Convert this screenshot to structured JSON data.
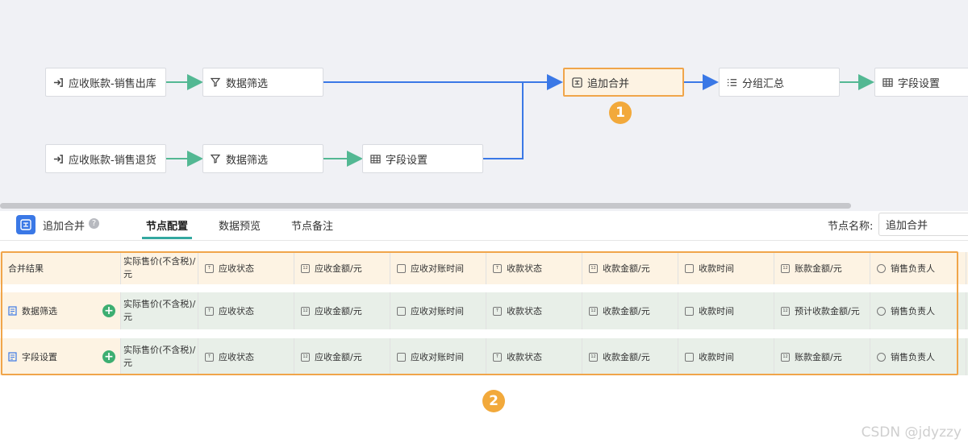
{
  "flow": {
    "nodes": [
      {
        "label": "应收账款-销售出库",
        "icon": "input-icon"
      },
      {
        "label": "数据筛选",
        "icon": "filter-icon"
      },
      {
        "label": "追加合并",
        "icon": "merge-icon"
      },
      {
        "label": "分组汇总",
        "icon": "list-icon"
      },
      {
        "label": "字段设置",
        "icon": "table-icon"
      },
      {
        "label": "应收账款-销售退货",
        "icon": "input-icon"
      },
      {
        "label": "数据筛选",
        "icon": "filter-icon"
      },
      {
        "label": "字段设置",
        "icon": "table-icon"
      }
    ],
    "badge1": "1",
    "badge2": "2",
    "colors": {
      "merge_edge": "#3a78e6",
      "flow_edge": "#53b893",
      "highlight": "#f0a54a"
    }
  },
  "panel": {
    "title": "追加合并",
    "help": "?",
    "tabs": [
      "节点配置",
      "数据预览",
      "节点备注"
    ],
    "active_tab": "节点配置",
    "node_name_label": "节点名称:",
    "node_name_value": "追加合并"
  },
  "table": {
    "rows": [
      {
        "label": "合并结果",
        "add": false,
        "cells": [
          "实际售价(不含税)/元",
          "应收状态",
          "应收金额/元",
          "应收对账时间",
          "收款状态",
          "收款金额/元",
          "收款时间",
          "账款金额/元",
          "销售负责人"
        ]
      },
      {
        "label": "数据筛选",
        "add": true,
        "cells": [
          "实际售价(不含税)/元",
          "应收状态",
          "应收金额/元",
          "应收对账时间",
          "收款状态",
          "收款金额/元",
          "收款时间",
          "预计收款金额/元",
          "销售负责人"
        ]
      },
      {
        "label": "字段设置",
        "add": true,
        "cells": [
          "实际售价(不含税)/元",
          "应收状态",
          "应收金额/元",
          "应收对账时间",
          "收款状态",
          "收款金额/元",
          "收款时间",
          "账款金额/元",
          "销售负责人"
        ]
      }
    ],
    "field_icons": [
      "text-icon",
      "number-icon",
      "date-icon",
      "text-icon",
      "number-icon",
      "date-icon",
      "number-icon",
      "user-icon"
    ]
  },
  "watermark": "CSDN @jdyzzy"
}
